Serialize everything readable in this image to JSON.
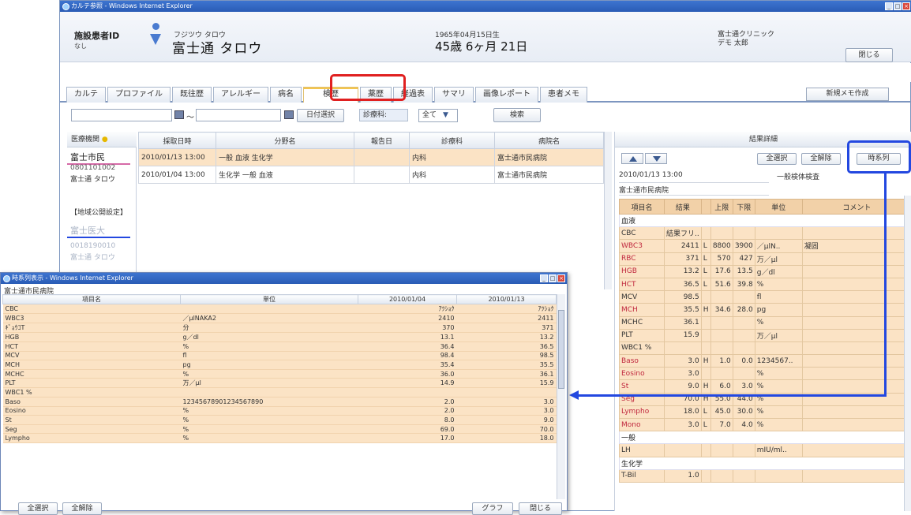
{
  "main_window": {
    "title": "カルテ参照 - Windows Internet Explorer"
  },
  "patient": {
    "id_label": "施設患者ID",
    "id_value": "なし",
    "name_kana": "フジツウ タロウ",
    "name": "富士通 タロウ",
    "dob": "1965年04月15日生",
    "age": "45歳 6ヶ月 21日",
    "clinic": "富士通クリニック",
    "doctor": "デモ 太郎",
    "close_label": "閉じる"
  },
  "tabs": [
    "カルテ",
    "プロファイル",
    "既往歴",
    "アレルギー",
    "病名",
    "検歴",
    "薬歴",
    "経過表",
    "サマリ",
    "画像レポート",
    "患者メモ"
  ],
  "new_memo_label": "新規メモ作成",
  "filter": {
    "date_from": "",
    "tilde": "～",
    "date_to": "",
    "date_select_label": "日付選択",
    "dept_label": "診療科:",
    "dept_value": "全て",
    "search_label": "検索"
  },
  "left_list": {
    "header": "医療機関",
    "items": [
      {
        "name": "富士市民",
        "id": "0801101002",
        "patient": "富士通 タロウ"
      }
    ],
    "disclosed_label": "【地域公開設定】",
    "items2": [
      {
        "name": "富士医大",
        "id": "0018190010",
        "patient": "富士通 タロウ"
      }
    ]
  },
  "exam_table": {
    "headers": [
      "採取日時",
      "分野名",
      "報告日",
      "診療科",
      "病院名"
    ],
    "rows": [
      [
        "2010/01/13 13:00",
        "一般 血液 生化学",
        "",
        "内科",
        "富士通市民病院"
      ],
      [
        "2010/01/04 13:00",
        "生化学 一般 血液",
        "",
        "内科",
        "富士通市民病院"
      ]
    ]
  },
  "result_panel": {
    "header": "結果詳細",
    "select_all_label": "全選択",
    "deselect_all_label": "全解除",
    "timeseries_label": "時系列",
    "datetime": "2010/01/13 13:00",
    "type": "一般検体検査",
    "hospital": "富士通市民病院",
    "headers": [
      "項目名",
      "結果",
      "",
      "上限",
      "下限",
      "単位",
      "コメント"
    ],
    "rows": [
      {
        "group": "血液"
      },
      {
        "cells": [
          "CBC",
          "結果フリ..",
          "",
          "",
          "",
          "",
          ""
        ],
        "red": false
      },
      {
        "cells": [
          "WBC3",
          "2411",
          "L",
          "8800",
          "3900",
          "／μlN..",
          "凝固"
        ],
        "red": true
      },
      {
        "cells": [
          "RBC",
          "371",
          "L",
          "570",
          "427",
          "万／μl",
          ""
        ],
        "red": true
      },
      {
        "cells": [
          "HGB",
          "13.2",
          "L",
          "17.6",
          "13.5",
          "g／dl",
          ""
        ],
        "red": true
      },
      {
        "cells": [
          "HCT",
          "36.5",
          "L",
          "51.6",
          "39.8",
          "%",
          ""
        ],
        "red": true
      },
      {
        "cells": [
          "MCV",
          "98.5",
          "",
          "",
          "",
          "fl",
          ""
        ],
        "red": false
      },
      {
        "cells": [
          "MCH",
          "35.5",
          "H",
          "34.6",
          "28.0",
          "pg",
          ""
        ],
        "red": true
      },
      {
        "cells": [
          "MCHC",
          "36.1",
          "",
          "",
          "",
          "%",
          ""
        ],
        "red": false
      },
      {
        "cells": [
          "PLT",
          "15.9",
          "",
          "",
          "",
          "万／μl",
          ""
        ],
        "red": false
      },
      {
        "cells": [
          "WBC1 %",
          "",
          "",
          "",
          "",
          "",
          ""
        ],
        "red": false
      },
      {
        "cells": [
          "Baso",
          "3.0",
          "H",
          "1.0",
          "0.0",
          "1234567..",
          ""
        ],
        "red": true
      },
      {
        "cells": [
          "Eosino",
          "3.0",
          "",
          "",
          "",
          "%",
          ""
        ],
        "red": true
      },
      {
        "cells": [
          "St",
          "9.0",
          "H",
          "6.0",
          "3.0",
          "%",
          ""
        ],
        "red": true
      },
      {
        "cells": [
          "Seg",
          "70.0",
          "H",
          "55.0",
          "44.0",
          "%",
          ""
        ],
        "red": true
      },
      {
        "cells": [
          "Lympho",
          "18.0",
          "L",
          "45.0",
          "30.0",
          "%",
          ""
        ],
        "red": true
      },
      {
        "cells": [
          "Mono",
          "3.0",
          "L",
          "7.0",
          "4.0",
          "%",
          ""
        ],
        "red": true
      },
      {
        "group": "一般"
      },
      {
        "cells": [
          "LH",
          "",
          "",
          "",
          "",
          "mIU/ml..",
          ""
        ],
        "red": false
      },
      {
        "group": "生化学"
      },
      {
        "cells": [
          "T-Bil",
          "1.0",
          "",
          "",
          "",
          "",
          ""
        ],
        "red": false
      }
    ]
  },
  "popup": {
    "title": "時系列表示 - Windows Internet Explorer",
    "hospital": "富士通市民病院",
    "headers": [
      "項目名",
      "単位",
      "2010/01/04",
      "2010/01/13"
    ],
    "rows": [
      [
        "CBC",
        "",
        "ｱﾂｼｮｸ",
        "ｱﾂｼｮｸ"
      ],
      [
        "WBC3",
        "／μlNAKA2",
        "2410",
        "2411"
      ],
      [
        "ｷﾞｮｳｺT",
        "分",
        "370",
        "371"
      ],
      [
        "HGB",
        "g／dl",
        "13.1",
        "13.2"
      ],
      [
        "HCT",
        "%",
        "36.4",
        "36.5"
      ],
      [
        "MCV",
        "fl",
        "98.4",
        "98.5"
      ],
      [
        "MCH",
        "pg",
        "35.4",
        "35.5"
      ],
      [
        "MCHC",
        "%",
        "36.0",
        "36.1"
      ],
      [
        "PLT",
        "万／μl",
        "14.9",
        "15.9"
      ],
      [
        "WBC1 %",
        "",
        "",
        ""
      ],
      [
        "Baso",
        "12345678901234567890",
        "2.0",
        "3.0"
      ],
      [
        "Eosino",
        "%",
        "2.0",
        "3.0"
      ],
      [
        "St",
        "%",
        "8.0",
        "9.0"
      ],
      [
        "Seg",
        "%",
        "69.0",
        "70.0"
      ],
      [
        "Lympho",
        "%",
        "17.0",
        "18.0"
      ]
    ],
    "select_all_label": "全選択",
    "deselect_all_label": "全解除",
    "graph_label": "グラフ",
    "close_label": "閉じる"
  },
  "colors": {
    "highlight_red": "#e02020",
    "highlight_blue": "#2348e0",
    "row_fill": "#fbe3c5"
  }
}
